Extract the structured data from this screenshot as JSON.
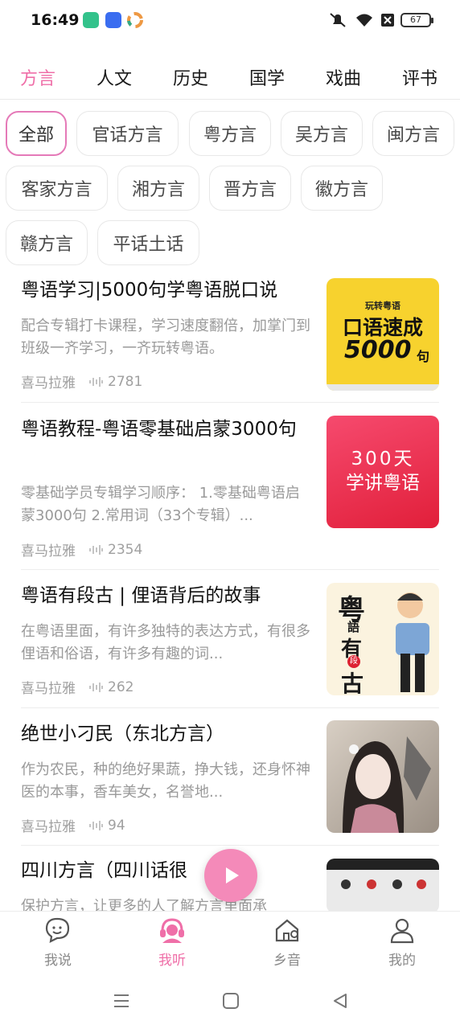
{
  "status_bar": {
    "time": "16:49",
    "battery": "67"
  },
  "top_tabs": [
    {
      "label": "方言",
      "active": true
    },
    {
      "label": "人文"
    },
    {
      "label": "历史"
    },
    {
      "label": "国学"
    },
    {
      "label": "戏曲"
    },
    {
      "label": "评书"
    }
  ],
  "filters": [
    {
      "label": "全部",
      "active": true
    },
    {
      "label": "官话方言"
    },
    {
      "label": "粤方言"
    },
    {
      "label": "吴方言"
    },
    {
      "label": "闽方言"
    },
    {
      "label": "客家方言"
    },
    {
      "label": "湘方言"
    },
    {
      "label": "晋方言"
    },
    {
      "label": "徽方言"
    },
    {
      "label": "赣方言"
    },
    {
      "label": "平话土话"
    }
  ],
  "list": [
    {
      "title": "粤语学习|5000句学粤语脱口说",
      "desc": "配合专辑打卡课程，学习速度翻倍，加掌门到班级一齐学习，一齐玩转粤语。",
      "source": "喜马拉雅",
      "plays": "2781",
      "cover": {
        "top": "玩转粤语",
        "main": "口语速成",
        "big": "5000",
        "suffix": "句"
      }
    },
    {
      "title": "粤语教程-粤语零基础启蒙3000句",
      "desc": "零基础学员专辑学习顺序： 1.零基础粤语启蒙3000句 2.常用词（33个专辑）...",
      "source": "喜马拉雅",
      "plays": "2354",
      "cover": {
        "line1": "300天",
        "line2": "学讲粤语"
      }
    },
    {
      "title": "粤语有段古 | 俚语背后的故事",
      "desc": "在粤语里面，有许多独特的表达方式，有很多俚语和俗语，有许多有趣的词...",
      "source": "喜马拉雅",
      "plays": "262",
      "cover": {
        "c1": "粤",
        "c2": "語",
        "c3": "有",
        "c4": "段",
        "c5": "古"
      }
    },
    {
      "title": "绝世小刁民（东北方言）",
      "desc": "作为农民，种的绝好果蔬，挣大钱，还身怀神医的本事，香车美女，名誉地...",
      "source": "喜马拉雅",
      "plays": "94"
    },
    {
      "title": "四川方言（四川话很",
      "desc": "保护方言，让更多的人了解方言里面承",
      "source": "",
      "plays": ""
    }
  ],
  "bottom_nav": [
    {
      "label": "我说",
      "icon": "face-chat-icon"
    },
    {
      "label": "我听",
      "icon": "headphones-user-icon",
      "active": true
    },
    {
      "label": "乡音",
      "icon": "home-location-icon"
    },
    {
      "label": "我的",
      "icon": "user-icon"
    }
  ],
  "colors": {
    "accent": "#ef6fa8",
    "chip_border_active": "#e57ab8",
    "fab": "#f48ab9"
  }
}
